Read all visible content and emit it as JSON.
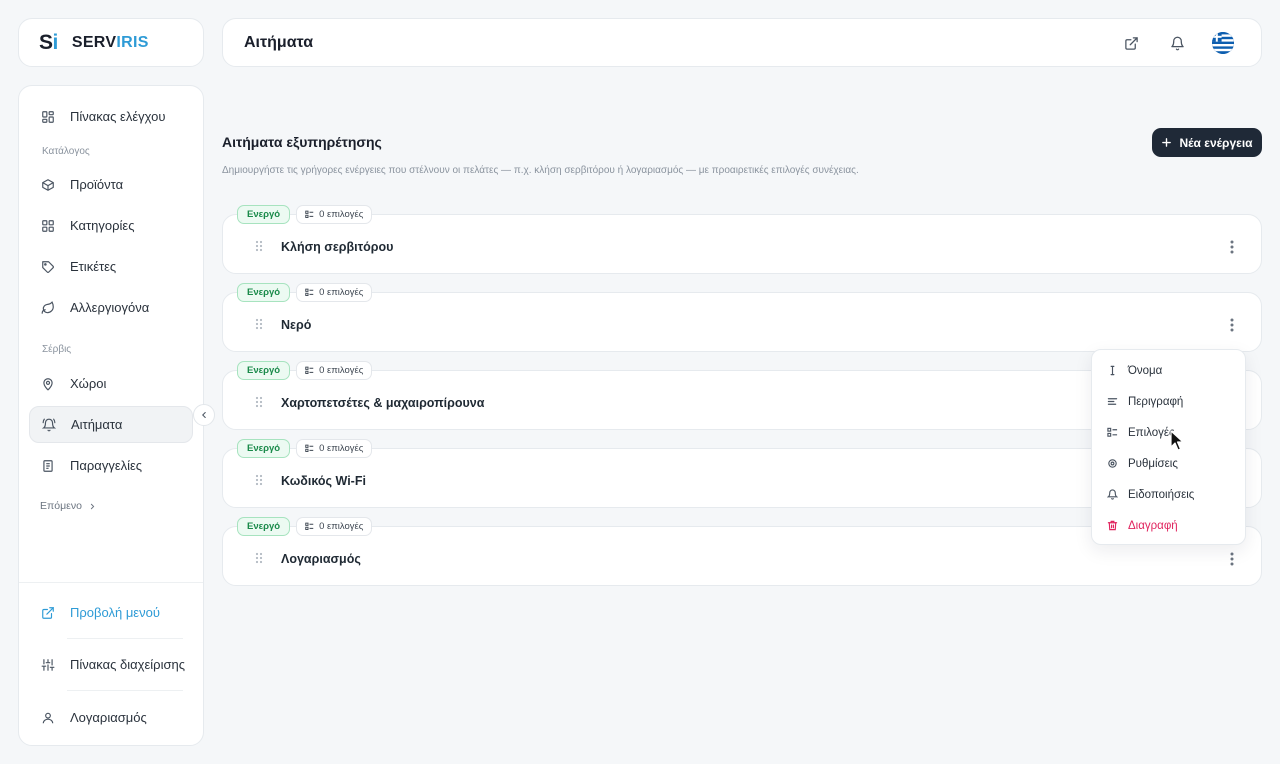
{
  "brand": {
    "mark_s": "S",
    "mark_i": "i",
    "name_a": "SERV",
    "name_b": "IRIS"
  },
  "header": {
    "title": "Αιτήματα"
  },
  "sidebar": {
    "dashboard": "Πίνακας ελέγχου",
    "section_catalog": "Κατάλογος",
    "products": "Προϊόντα",
    "categories": "Κατηγορίες",
    "tags": "Ετικέτες",
    "allergens": "Αλλεργιογόνα",
    "section_service": "Σέρβις",
    "spaces": "Χώροι",
    "requests": "Αιτήματα",
    "orders": "Παραγγελίες",
    "next": "Επόμενο",
    "view_menu": "Προβολή μενού",
    "admin_panel": "Πίνακας διαχείρισης",
    "account": "Λογαριασμός"
  },
  "main": {
    "title": "Αιτήματα εξυπηρέτησης",
    "description": "Δημιουργήστε τις γρήγορες ενέργειες που στέλνουν οι πελάτες — π.χ. κλήση σερβιτόρου ή λογαριασμός — με προαιρετικές επιλογές συνέχειας.",
    "new_action": "Νέα ενέργεια",
    "requests": [
      {
        "status": "Ενεργό",
        "options": "0 επιλογές",
        "title": "Κλήση σερβιτόρου"
      },
      {
        "status": "Ενεργό",
        "options": "0 επιλογές",
        "title": "Νερό"
      },
      {
        "status": "Ενεργό",
        "options": "0 επιλογές",
        "title": "Χαρτοπετσέτες & μαχαιροπίρουνα"
      },
      {
        "status": "Ενεργό",
        "options": "0 επιλογές",
        "title": "Κωδικός Wi-Fi"
      },
      {
        "status": "Ενεργό",
        "options": "0 επιλογές",
        "title": "Λογαριασμός"
      }
    ]
  },
  "menu": {
    "name": "Όνομα",
    "description": "Περιγραφή",
    "options": "Επιλογές",
    "settings": "Ρυθμίσεις",
    "notifications": "Ειδοποιήσεις",
    "delete": "Διαγραφή"
  },
  "colors": {
    "accent": "#2e9bd6",
    "primary_button": "#1f2937",
    "active_badge": "#1a8a4a",
    "danger": "#e0245e"
  }
}
